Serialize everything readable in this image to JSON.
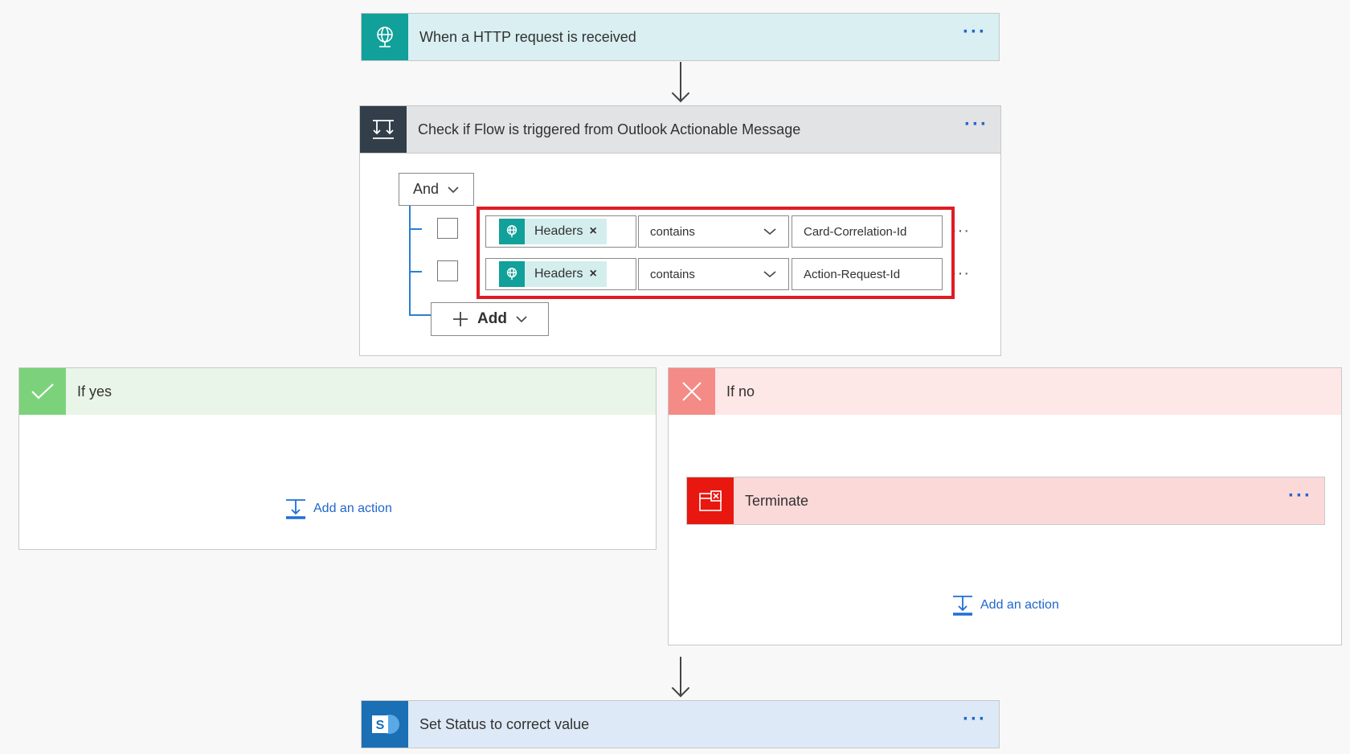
{
  "trigger": {
    "title": "When a HTTP request is received",
    "more": "···",
    "bg": "#d9eff2",
    "icon_bg": "#11a09a",
    "icon": "globe-icon"
  },
  "condition": {
    "title": "Check if Flow is triggered from Outlook Actionable Message",
    "more": "···",
    "header_bg": "#e2e3e5",
    "icon_bg": "#323e4a",
    "icon": "condition-icon",
    "group_operator": "And",
    "rows": [
      {
        "token": "Headers",
        "remove": "×",
        "operator": "contains",
        "value": "Card-Correlation-Id",
        "more": "···"
      },
      {
        "token": "Headers",
        "remove": "×",
        "operator": "contains",
        "value": "Action-Request-Id",
        "more": "···"
      }
    ],
    "add_label": "Add",
    "highlight_color": "#e01b24"
  },
  "if_yes": {
    "title": "If yes",
    "add_action": "Add an action",
    "header_bg": "#e8f5e8",
    "icon_bg": "#7bd27b"
  },
  "if_no": {
    "title": "If no",
    "add_action": "Add an action",
    "header_bg": "#fde7e7",
    "icon_bg": "#f48b86",
    "terminate": {
      "title": "Terminate",
      "more": "···",
      "bg": "#fbd9d9",
      "icon_bg": "#e8170f"
    }
  },
  "final_step": {
    "title": "Set Status to correct value",
    "more": "···",
    "bg": "#dde9f6",
    "icon_bg": "#1a6fb5",
    "icon": "sharepoint-icon"
  }
}
